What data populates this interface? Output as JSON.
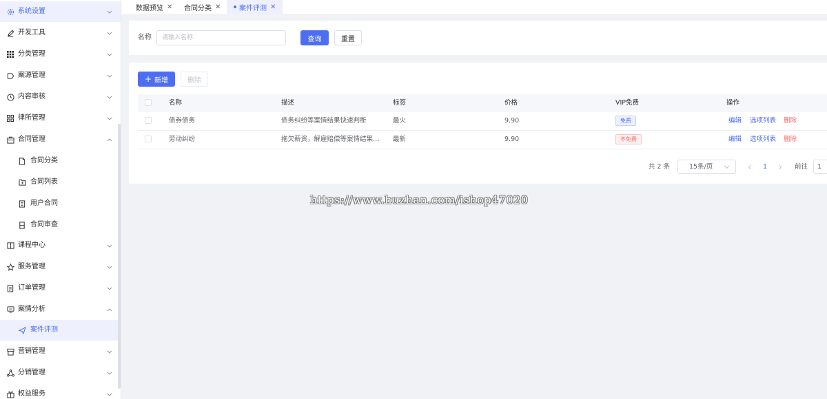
{
  "sidebar": {
    "items": [
      {
        "label": "系统设置",
        "icon": "gear-icon"
      },
      {
        "label": "开发工具",
        "icon": "pen-icon"
      },
      {
        "label": "分类管理",
        "icon": "grid-icon"
      },
      {
        "label": "案源管理",
        "icon": "tag-icon"
      },
      {
        "label": "内容审核",
        "icon": "compass-icon"
      },
      {
        "label": "律所管理",
        "icon": "apps-icon"
      },
      {
        "label": "合同管理",
        "icon": "briefcase-icon"
      },
      {
        "label": "合同分类",
        "icon": "document-icon"
      },
      {
        "label": "合同列表",
        "icon": "folder-icon"
      },
      {
        "label": "用户合同",
        "icon": "list-doc-icon"
      },
      {
        "label": "合同审查",
        "icon": "file-icon"
      },
      {
        "label": "课程中心",
        "icon": "book-icon"
      },
      {
        "label": "服务管理",
        "icon": "star-icon"
      },
      {
        "label": "订单管理",
        "icon": "order-icon"
      },
      {
        "label": "案情分析",
        "icon": "monitor-icon"
      },
      {
        "label": "案件评测",
        "icon": "send-icon"
      },
      {
        "label": "营销管理",
        "icon": "shop-icon"
      },
      {
        "label": "分销管理",
        "icon": "share-icon"
      },
      {
        "label": "权益服务",
        "icon": "gift-icon"
      }
    ]
  },
  "tabs": [
    {
      "label": "数据预览"
    },
    {
      "label": "合同分类"
    },
    {
      "label": "案件评测"
    }
  ],
  "search": {
    "label": "名称",
    "placeholder": "请输入名称",
    "query_label": "查询",
    "reset_label": "重置"
  },
  "toolbar": {
    "add_label": "新增",
    "delete_label": "删除"
  },
  "table": {
    "headers": [
      "名称",
      "描述",
      "标签",
      "价格",
      "VIP免费",
      "操作"
    ],
    "rows": [
      {
        "name": "债券债务",
        "desc": "债务纠纷等案情结果快速判断",
        "tag": "最火",
        "price": "9.90",
        "vip": "免费",
        "vip_free": true
      },
      {
        "name": "劳动纠纷",
        "desc": "拖欠薪资，解雇赔偿等案情结果快速判断",
        "tag": "最新",
        "price": "9.90",
        "vip": "不免费",
        "vip_free": false
      }
    ],
    "actions": {
      "edit": "编辑",
      "options": "选项列表",
      "delete": "删除"
    }
  },
  "pagination": {
    "total": "共 2 条",
    "page_size": "15条/页",
    "current_page": "1",
    "goto_label": "前往",
    "goto_value": "1"
  },
  "watermark": "https://www.huzhan.com/ishop47020",
  "colors": {
    "accent": "#4e6ef2",
    "danger": "#f56c6c"
  }
}
